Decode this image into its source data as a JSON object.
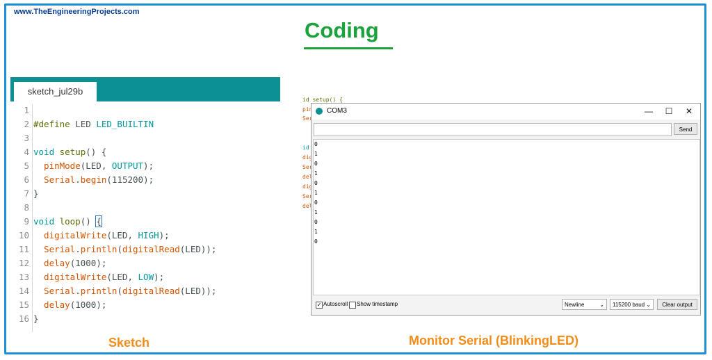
{
  "site": "www.TheEngineeringProjects.com",
  "title": "Coding",
  "sketch": {
    "tab": "sketch_jul29b",
    "lines": [
      {
        "n": "1"
      },
      {
        "n": "2"
      },
      {
        "n": "3"
      },
      {
        "n": "4"
      },
      {
        "n": "5"
      },
      {
        "n": "6"
      },
      {
        "n": "7"
      },
      {
        "n": "8"
      },
      {
        "n": "9"
      },
      {
        "n": "10"
      },
      {
        "n": "11"
      },
      {
        "n": "12"
      },
      {
        "n": "13"
      },
      {
        "n": "14"
      },
      {
        "n": "15"
      },
      {
        "n": "16"
      }
    ],
    "code": {
      "l2_a": "#define",
      "l2_b": " LED ",
      "l2_c": "LED_BUILTIN",
      "l4_a": "void",
      "l4_b": " setup",
      "l4_c": "() {",
      "l5_a": "  pinMode",
      "l5_b": "(LED, ",
      "l5_c": "OUTPUT",
      "l5_d": ");",
      "l6_a": "  Serial",
      "l6_b": ".",
      "l6_c": "begin",
      "l6_d": "(115200);",
      "l7": "}",
      "l9_a": "void",
      "l9_b": " loop",
      "l9_c": "() ",
      "l9_d": "{",
      "l10_a": "  digitalWrite",
      "l10_b": "(LED, ",
      "l10_c": "HIGH",
      "l10_d": ");",
      "l11_a": "  Serial",
      "l11_b": ".",
      "l11_c": "println",
      "l11_d": "(",
      "l11_e": "digitalRead",
      "l11_f": "(LED));",
      "l12_a": "  delay",
      "l12_b": "(1000);",
      "l13_a": "  digitalWrite",
      "l13_b": "(LED, ",
      "l13_c": "LOW",
      "l13_d": ");",
      "l14_a": "  Serial",
      "l14_b": ".",
      "l14_c": "println",
      "l14_d": "(",
      "l14_e": "digitalRead",
      "l14_f": "(LED));",
      "l15_a": "  delay",
      "l15_b": "(1000);",
      "l16": "}"
    },
    "caption": "Sketch"
  },
  "background_code": [
    "id setup() {",
    "pin",
    "Ser",
    "id",
    "dig",
    "Ser",
    "del",
    "dig",
    "Ser",
    "del"
  ],
  "monitor": {
    "title": "COM3",
    "minimize": "—",
    "maximize": "☐",
    "close": "✕",
    "send_label": "Send",
    "output": [
      "0",
      "1",
      "0",
      "1",
      "0",
      "1",
      "0",
      "1",
      "0",
      "1",
      "0"
    ],
    "autoscroll_label": "Autoscroll",
    "autoscroll_checked": "✓",
    "timestamp_label": "Show timestamp",
    "line_ending": "Newline",
    "baud": "115200 baud",
    "clear_label": "Clear output",
    "caption": "Monitor Serial (BlinkingLED)"
  },
  "icons": {
    "dropdown": "chevron-down-icon",
    "app": "arduino-icon"
  },
  "colors": {
    "frame": "#1e8fd6",
    "title": "#19a33a",
    "caption": "#f28c1a",
    "tabbar": "#0d8f96"
  }
}
